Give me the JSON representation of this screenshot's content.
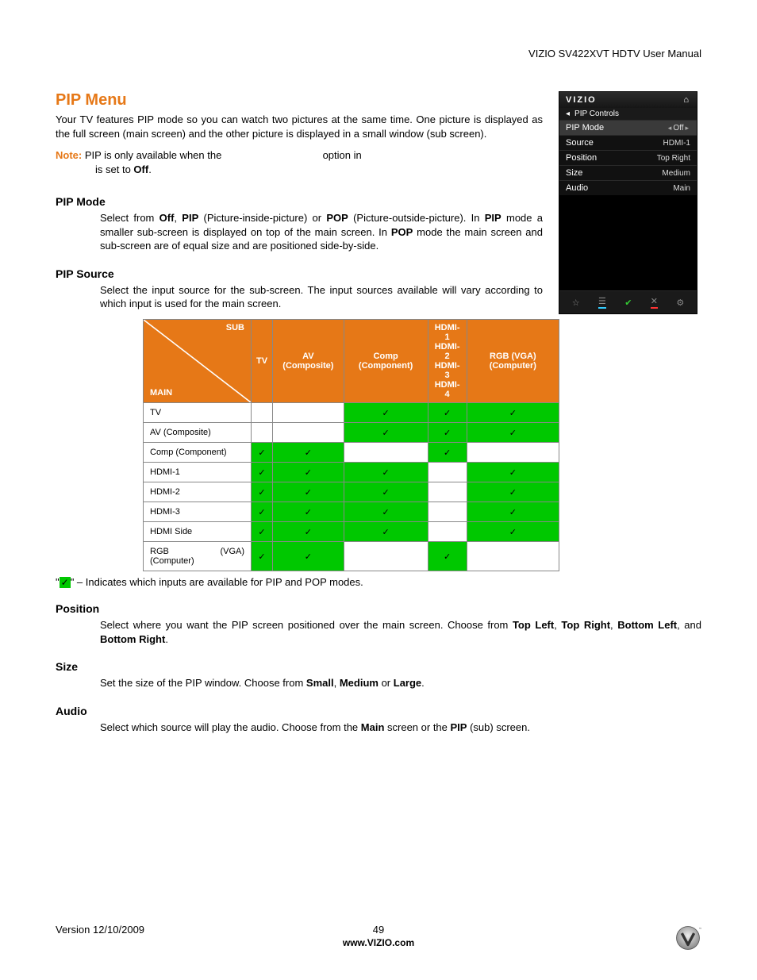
{
  "header": {
    "product_line": "VIZIO SV422XVT HDTV User Manual"
  },
  "title": "PIP Menu",
  "intro": "Your TV features PIP mode so you can watch two pictures at the same time. One picture is displayed as the full screen (main screen) and the other picture is displayed in a small window (sub screen).",
  "note": {
    "label": "Note:",
    "line1_a": "PIP is only available when the",
    "line1_b": "option in",
    "line2_a": "is set to ",
    "line2_b": "Off",
    "line2_c": "."
  },
  "sections": {
    "pip_mode": {
      "heading": "PIP Mode",
      "body_parts": [
        "Select from ",
        "Off",
        ", ",
        "PIP",
        " (Picture-inside-picture) or ",
        "POP",
        " (Picture-outside-picture). In ",
        "PIP",
        " mode a smaller sub-screen is displayed on top of the main screen. In ",
        "POP",
        " mode the main screen and sub-screen are of equal size and are positioned side-by-side."
      ]
    },
    "pip_source": {
      "heading": "PIP Source",
      "body": "Select the input source for the sub-screen. The input sources available will vary according to which input is used for the main screen."
    },
    "position": {
      "heading": "Position",
      "body_parts": [
        "Select where you want the PIP screen positioned over the main screen. Choose from ",
        "Top Left",
        ", ",
        "Top Right",
        ", ",
        "Bottom Left",
        ", and ",
        "Bottom Right",
        "."
      ]
    },
    "size": {
      "heading": "Size",
      "body_parts": [
        "Set the size of the PIP window. Choose from ",
        "Small",
        ", ",
        "Medium",
        " or ",
        "Large",
        "."
      ]
    },
    "audio": {
      "heading": "Audio",
      "body_parts": [
        "Select which source will play the audio. Choose from the ",
        "Main",
        " screen or the ",
        "PIP",
        " (sub) screen."
      ]
    }
  },
  "osd": {
    "brand": "VIZIO",
    "breadcrumb": "PIP Controls",
    "rows": [
      {
        "label": "PIP Mode",
        "value": "Off",
        "selected": true,
        "arrows": true
      },
      {
        "label": "Source",
        "value": "HDMI-1"
      },
      {
        "label": "Position",
        "value": "Top Right"
      },
      {
        "label": "Size",
        "value": "Medium"
      },
      {
        "label": "Audio",
        "value": "Main"
      }
    ]
  },
  "table": {
    "corner_sub": "SUB",
    "corner_main": "MAIN",
    "columns": [
      "TV",
      "AV (Composite)",
      "Comp (Component)",
      "HDMI-1 HDMI-2 HDMI-3 HDMI-4",
      "RGB (VGA) (Computer)"
    ],
    "rows": [
      {
        "label": "TV",
        "cells": [
          false,
          false,
          true,
          true,
          true
        ]
      },
      {
        "label": "AV (Composite)",
        "cells": [
          false,
          false,
          true,
          true,
          true
        ]
      },
      {
        "label": "Comp (Component)",
        "cells": [
          true,
          true,
          false,
          true,
          false
        ]
      },
      {
        "label": "HDMI-1",
        "cells": [
          true,
          true,
          true,
          false,
          true
        ]
      },
      {
        "label": "HDMI-2",
        "cells": [
          true,
          true,
          true,
          false,
          true
        ]
      },
      {
        "label": "HDMI-3",
        "cells": [
          true,
          true,
          true,
          false,
          true
        ]
      },
      {
        "label": "HDMI Side",
        "cells": [
          true,
          true,
          true,
          false,
          true
        ]
      },
      {
        "label": "RGB (VGA) (Computer)",
        "cells": [
          true,
          true,
          false,
          true,
          false
        ],
        "justify": true
      }
    ]
  },
  "legend": {
    "pre": "\"",
    "mark": "✓",
    "post": "\" – Indicates which inputs are available for PIP and POP modes."
  },
  "footer": {
    "version": "Version 12/10/2009",
    "page": "49",
    "url": "www.VIZIO.com"
  },
  "chart_data": {
    "type": "table",
    "title": "PIP/POP input compatibility (Main vs Sub)",
    "row_axis": "Main input",
    "col_axis": "Sub input",
    "columns": [
      "TV",
      "AV (Composite)",
      "Comp (Component)",
      "HDMI-1/2/3/4",
      "RGB (VGA) (Computer)"
    ],
    "rows": [
      "TV",
      "AV (Composite)",
      "Comp (Component)",
      "HDMI-1",
      "HDMI-2",
      "HDMI-3",
      "HDMI Side",
      "RGB (VGA) (Computer)"
    ],
    "values": [
      [
        0,
        0,
        1,
        1,
        1
      ],
      [
        0,
        0,
        1,
        1,
        1
      ],
      [
        1,
        1,
        0,
        1,
        0
      ],
      [
        1,
        1,
        1,
        0,
        1
      ],
      [
        1,
        1,
        1,
        0,
        1
      ],
      [
        1,
        1,
        1,
        0,
        1
      ],
      [
        1,
        1,
        1,
        0,
        1
      ],
      [
        1,
        1,
        0,
        1,
        0
      ]
    ],
    "legend": "1 = available for PIP/POP, 0 = not available"
  }
}
